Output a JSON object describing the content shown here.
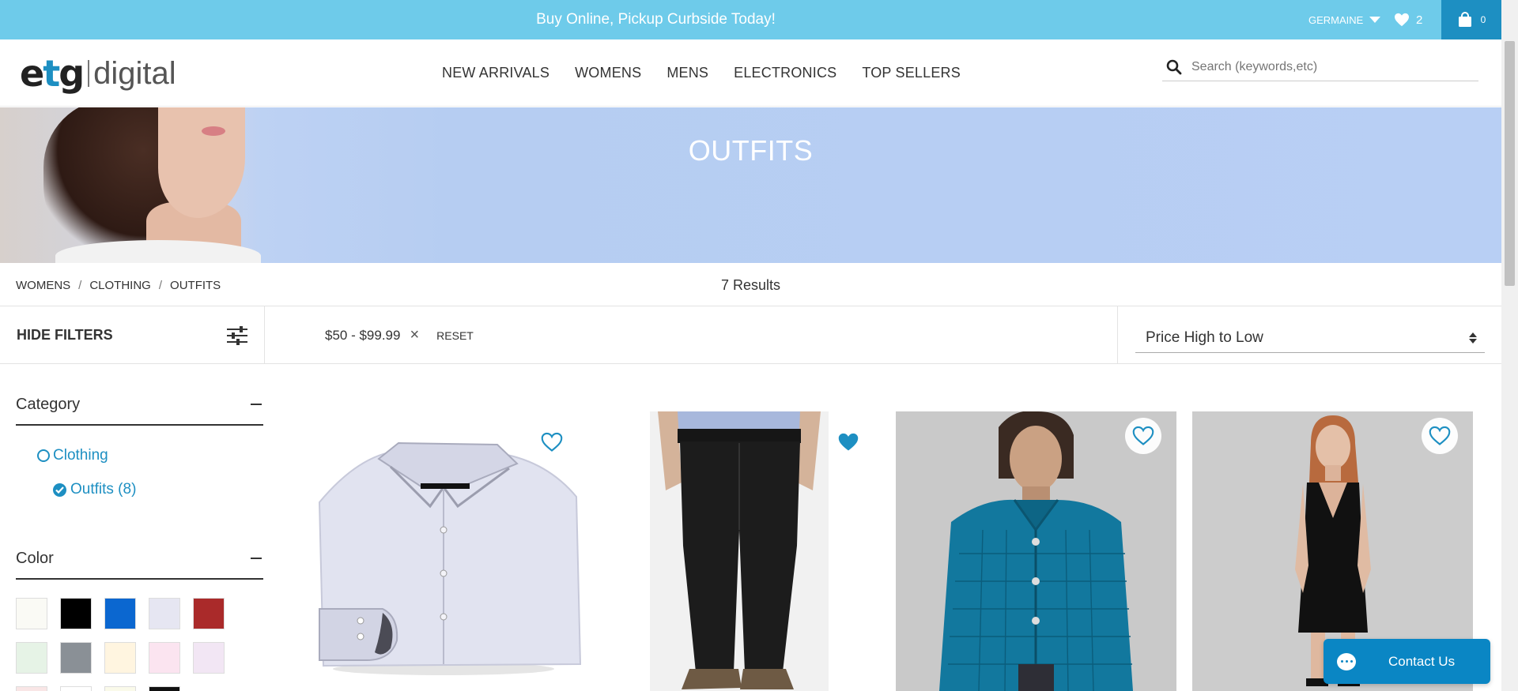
{
  "promo": {
    "text": "Buy Online, Pickup Curbside Today!"
  },
  "account": {
    "user_name": "GERMAINE",
    "wishlist_count": "2",
    "cart_count": "0"
  },
  "logo": {
    "text_etg": "etg",
    "text_digital": "digital"
  },
  "nav": {
    "items": [
      "NEW ARRIVALS",
      "WOMENS",
      "MENS",
      "ELECTRONICS",
      "TOP SELLERS"
    ]
  },
  "search": {
    "placeholder": "Search (keywords,etc)"
  },
  "banner": {
    "title": "OUTFITS"
  },
  "breadcrumb": {
    "items": [
      "WOMENS",
      "CLOTHING",
      "OUTFITS"
    ],
    "separator": "/"
  },
  "results": {
    "text": "7 Results"
  },
  "filters": {
    "hide_label": "HIDE FILTERS",
    "active_filter": "$50 - $99.99",
    "remove_symbol": "×",
    "reset_label": "RESET"
  },
  "sort": {
    "selected": "Price High to Low"
  },
  "sidebar": {
    "category_title": "Category",
    "categories": [
      {
        "label": "Clothing",
        "selected": false
      },
      {
        "label": "Outfits (8)",
        "selected": true
      }
    ],
    "color_title": "Color",
    "colors": [
      "#fafaf5",
      "#000000",
      "#0b67d0",
      "#e6e6f2",
      "#aa2a2a",
      "#e6f3e6",
      "#8a9096",
      "#fff5e0",
      "#fbe4f0",
      "#f2e6f4",
      "#f9e6e6",
      "#ffffff",
      "#fafaea",
      "#111111"
    ]
  },
  "products": [
    {
      "name": "dress-shirt",
      "favorited": false
    },
    {
      "name": "black-trousers",
      "favorited": true
    },
    {
      "name": "quilted-jacket",
      "favorited": false
    },
    {
      "name": "black-dress",
      "favorited": false
    }
  ],
  "contact": {
    "label": "Contact Us"
  },
  "colors": {
    "accent": "#1d8fc2",
    "promo_bg": "#6ecbea",
    "banner_bg": "#b8cff4"
  }
}
